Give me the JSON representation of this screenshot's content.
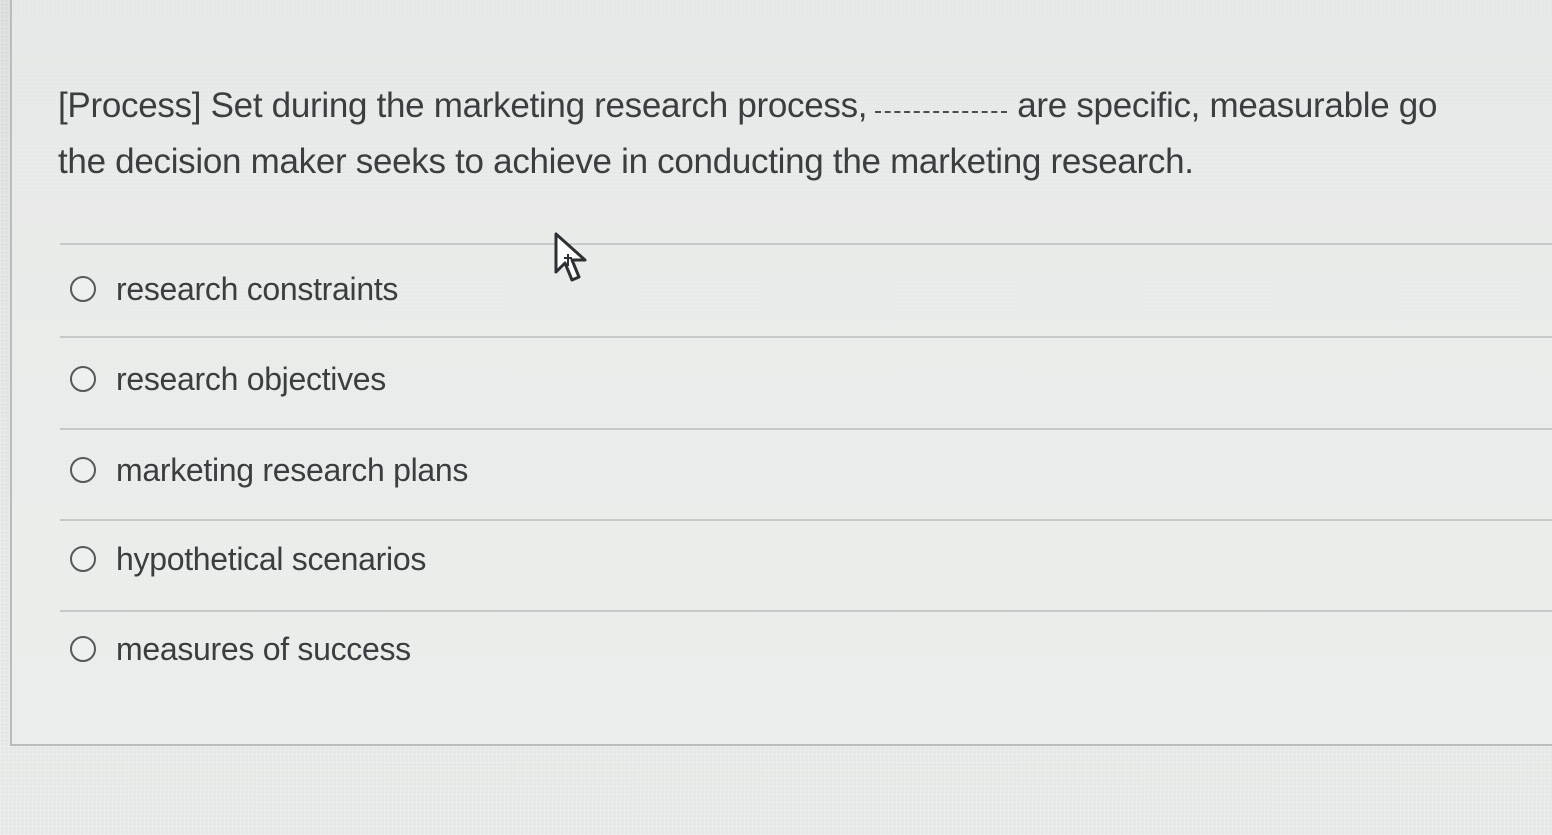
{
  "question": {
    "text_before_blank": "[Process] Set during the marketing research process,",
    "text_after_blank": "are specific, measurable go",
    "line2": "the decision maker seeks to achieve in conducting the marketing research."
  },
  "options": [
    {
      "label": "research constraints",
      "selected": false
    },
    {
      "label": "research objectives",
      "selected": false
    },
    {
      "label": "marketing research plans",
      "selected": false
    },
    {
      "label": "hypothetical scenarios",
      "selected": false
    },
    {
      "label": "measures of success",
      "selected": false
    }
  ],
  "colors": {
    "text": "#3b3e40",
    "divider": "#c6c9c8",
    "radio_border": "#55595b",
    "background": "#e3e5e4"
  },
  "icons": {
    "radio": "radio-unchecked-icon",
    "cursor": "mouse-pointer-icon"
  }
}
